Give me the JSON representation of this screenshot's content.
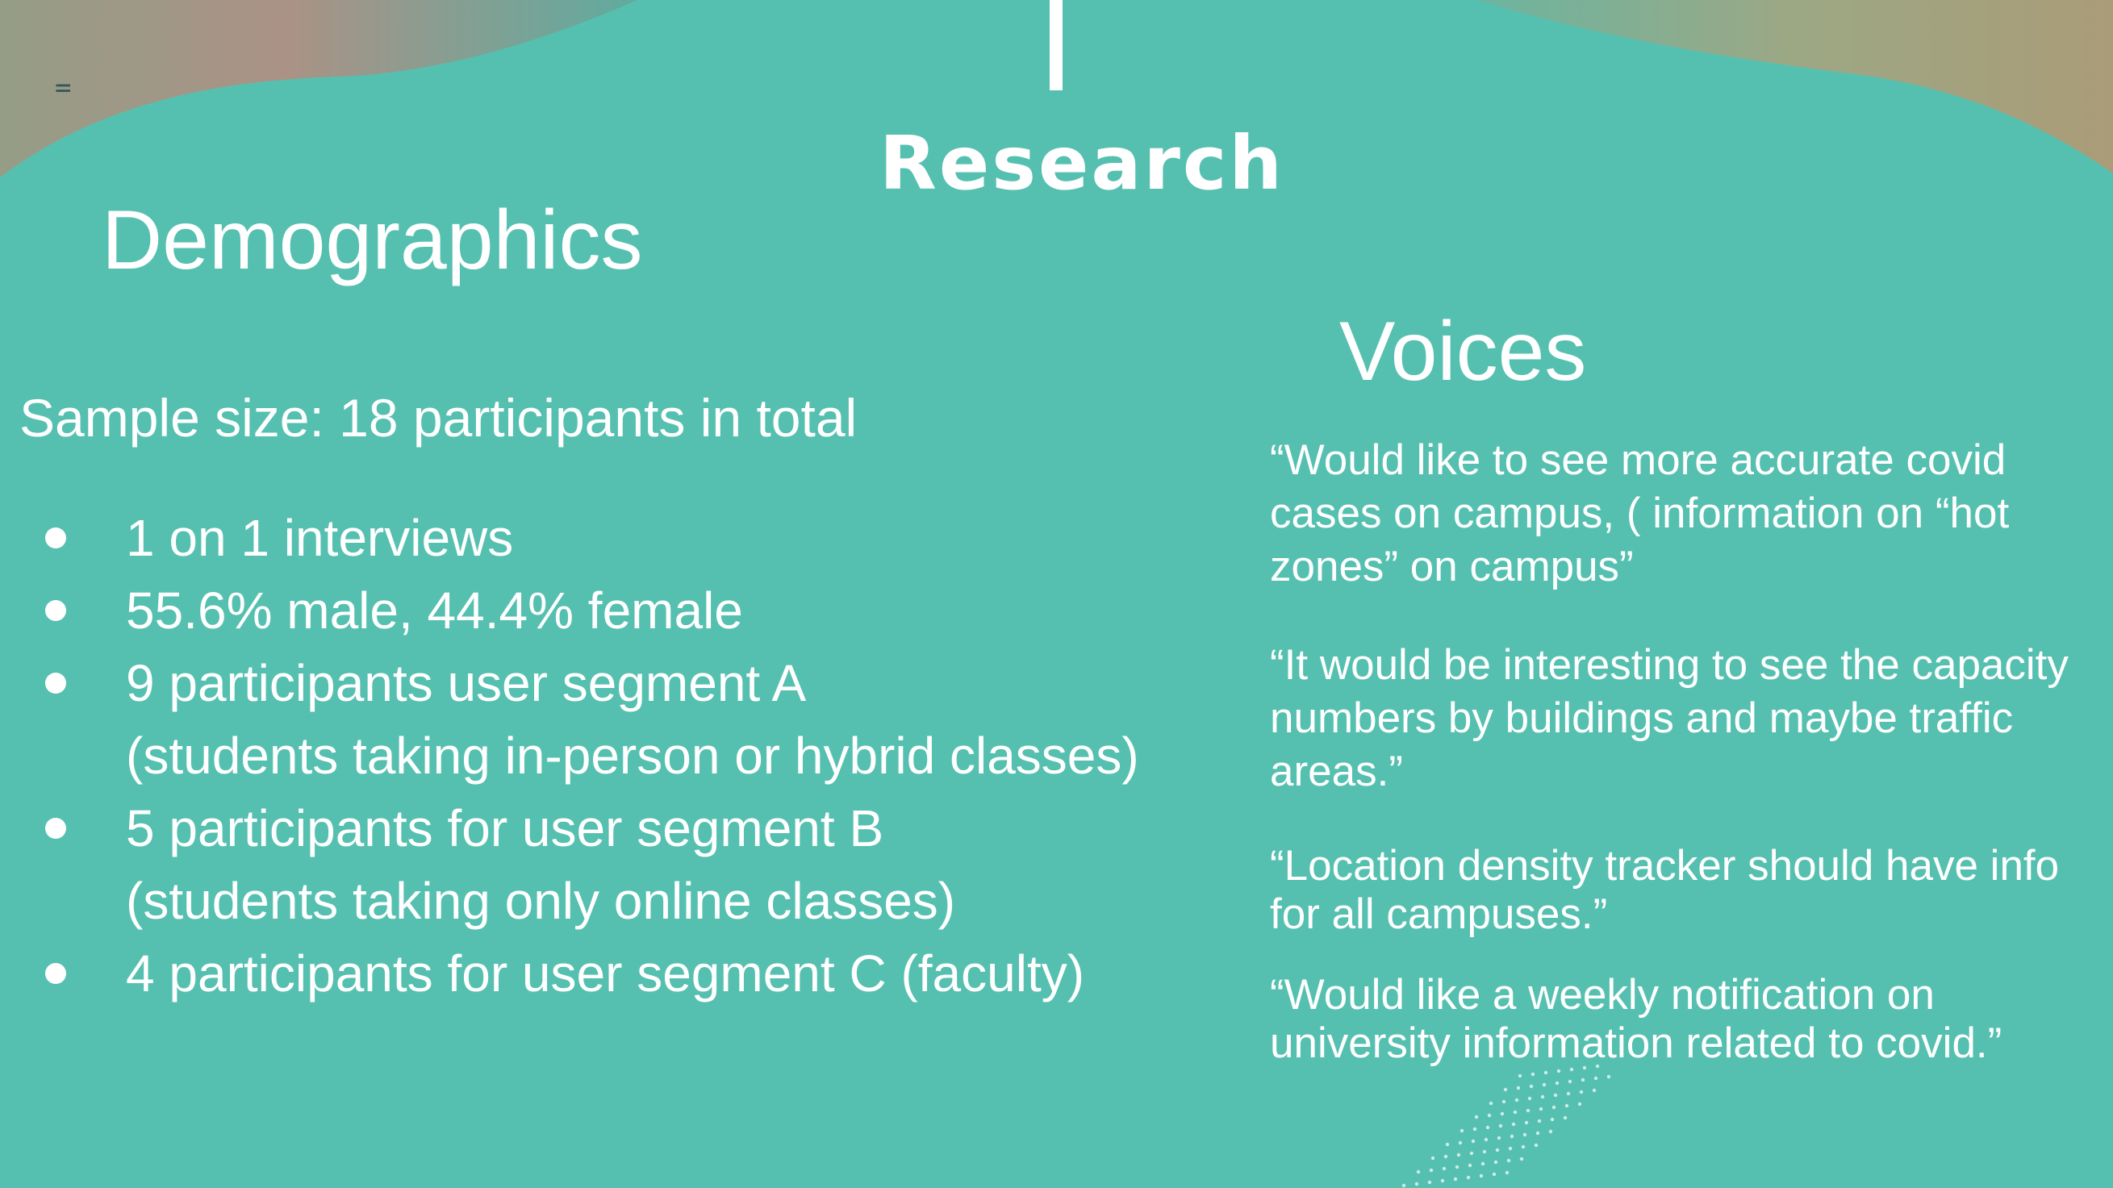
{
  "slide": {
    "title": "Research",
    "menu_icon": "hamburger-menu-icon",
    "menu_glyph": "=",
    "colors": {
      "background": "#56c0b0",
      "text": "#ffffff",
      "accent_left": "#c98a7a",
      "accent_right": "#d4a06e"
    }
  },
  "demographics": {
    "heading": "Demographics",
    "sample_size": "Sample size: 18 participants in total",
    "bullets": [
      {
        "line1": "1 on 1 interviews",
        "line2": ""
      },
      {
        "line1": "55.6% male, 44.4% female",
        "line2": ""
      },
      {
        "line1": "9 participants user segment A",
        "line2": "(students taking in-person or hybrid classes)"
      },
      {
        "line1": "5 participants for user segment B",
        "line2": "(students taking only online classes)"
      },
      {
        "line1": "4 participants for user segment C (faculty)",
        "line2": ""
      }
    ]
  },
  "voices": {
    "heading": "Voices",
    "quotes": [
      "“Would like to see more accurate covid cases on campus, ( information on “hot zones” on campus”",
      "“It would be interesting to see the capacity numbers  by buildings and maybe traffic areas.”",
      "“Location density tracker should have info for all campuses.”",
      "“Would like a weekly  notification on university information related to covid.”"
    ]
  }
}
